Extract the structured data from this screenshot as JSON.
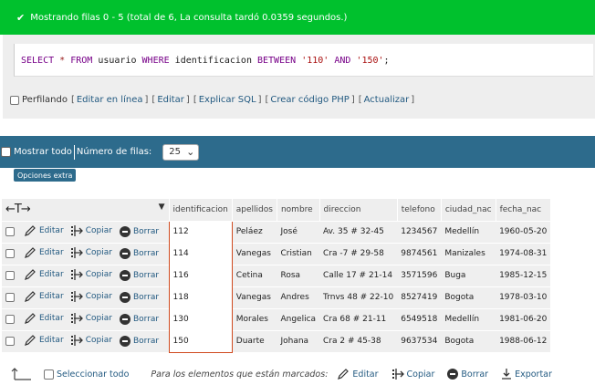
{
  "success": {
    "message": "Mostrando filas 0 - 5 (total de 6, La consulta tardó 0.0359 segundos.)"
  },
  "sql": {
    "kw_select": "SELECT",
    "star": "*",
    "kw_from": "FROM",
    "table": "usuario",
    "kw_where": "WHERE",
    "column": "identificacion",
    "kw_between": "BETWEEN",
    "val1": "'110'",
    "kw_and": "AND",
    "val2": "'150'",
    "end": ";"
  },
  "query_actions": {
    "profiling": "Perfilando",
    "edit_inline": "Editar en línea",
    "edit": "Editar",
    "explain": "Explicar SQL",
    "create_php": "Crear código PHP",
    "refresh": "Actualizar"
  },
  "navbar": {
    "show_all": "Mostrar todo",
    "rows_label": "Número de filas:",
    "rows_value": "25"
  },
  "extra_options": "Opciones extra",
  "columns": [
    "identificacion",
    "apellidos",
    "nombre",
    "direccion",
    "telefono",
    "ciudad_nac",
    "fecha_nac"
  ],
  "row_actions": {
    "edit": "Editar",
    "copy": "Copiar",
    "delete": "Borrar"
  },
  "rows": [
    [
      "112",
      "Peláez",
      "José",
      "Av. 35 # 32-45",
      "1234567",
      "Medellín",
      "1960-05-20"
    ],
    [
      "114",
      "Vanegas",
      "Cristian",
      "Cra -7 # 29-58",
      "9874561",
      "Manizales",
      "1974-08-31"
    ],
    [
      "116",
      "Cetina",
      "Rosa",
      "Calle 17 # 21-14",
      "3571596",
      "Buga",
      "1985-12-15"
    ],
    [
      "118",
      "Vanegas",
      "Andres",
      "Trnvs 48 # 22-10",
      "8527419",
      "Bogota",
      "1978-03-10"
    ],
    [
      "130",
      "Morales",
      "Angelica",
      "Cra 68 # 21-11",
      "6549518",
      "Medellín",
      "1981-06-20"
    ],
    [
      "150",
      "Duarte",
      "Johana",
      "Cra 2 # 45-38",
      "9637534",
      "Bogota",
      "1988-06-12"
    ]
  ],
  "bottom": {
    "select_all": "Seleccionar todo",
    "selected_label": "Para los elementos que están marcados:",
    "edit": "Editar",
    "copy": "Copiar",
    "delete": "Borrar",
    "export": "Exportar"
  },
  "colors": {
    "success": "#00c12d",
    "navbar": "#2d6b8c",
    "link": "#235a81",
    "highlight_border": "#d04a1f"
  }
}
